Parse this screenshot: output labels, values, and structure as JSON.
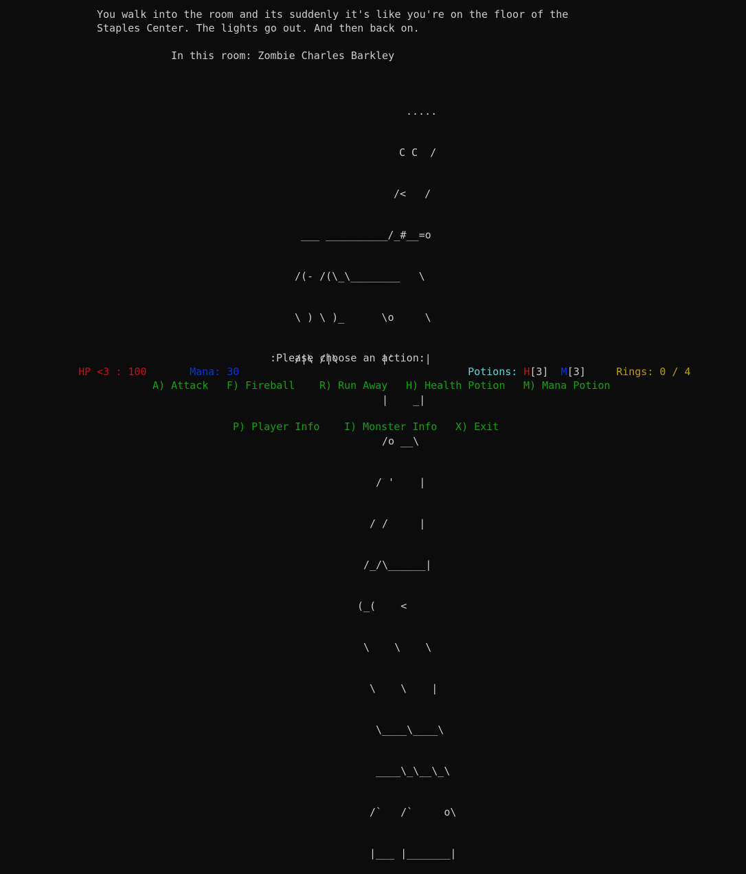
{
  "narration": {
    "line1": "You walk into the room and its suddenly it's like you're on the floor of the",
    "line2": "Staples Center. The lights go out. And then back on.",
    "room_contents": "In this room: Zombie Charles Barkley"
  },
  "ascii_art": [
    ".....",
    "C C  /",
    "/<   /",
    "___ __________/_#__=o",
    "/(- /(\\_\\________   \\",
    "\\ ) \\ )_      \\o     \\",
    "/|\\ /|\\       |'     |",
    "|    _|",
    "/o __\\",
    "/ '    |",
    "/ /     |",
    "/_/\\______|",
    "(_(    <",
    "\\    \\    \\",
    "\\    \\    |",
    "\\____\\____\\",
    "____\\_\\__\\_\\",
    "/`   /`     o\\",
    "|___ |_______|"
  ],
  "status": {
    "hp_label": "HP <3 : ",
    "hp_value": "100",
    "mana_label": "Mana: ",
    "mana_value": "30",
    "prompt": ":Please choose an action:",
    "potions_label": "Potions: ",
    "health_potion_letter": "H",
    "health_potion_count": "[3]",
    "mana_potion_letter": "M",
    "mana_potion_count": "[3]",
    "rings_label": "Rings: ",
    "rings_value": "0 / 4"
  },
  "actions_row1": [
    "A) Attack",
    "F) Fireball",
    "R) Run Away",
    "H) Health Potion",
    "M) Mana Potion"
  ],
  "actions_row2": [
    "P) Player Info",
    "I) Monster Info",
    "X) Exit"
  ],
  "colors": {
    "background": "#0c0c0c",
    "text": "#cccccc",
    "hp": "#c50f1f",
    "mana": "#0037da",
    "potions": "#61d6d6",
    "rings": "#c19c00",
    "actions": "#13a10e"
  }
}
